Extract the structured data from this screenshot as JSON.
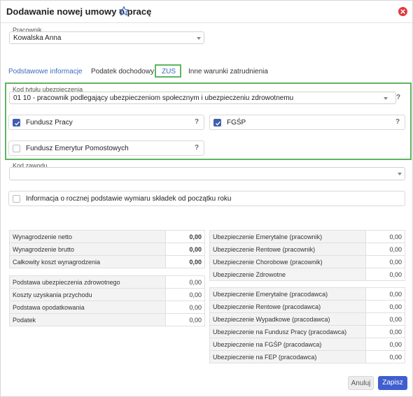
{
  "dialog": {
    "title": "Dodawanie nowej umowy o pracę"
  },
  "employee": {
    "label": "Pracownik",
    "value": "Kowalska Anna"
  },
  "tabs": [
    {
      "label": "Podstawowe informacje"
    },
    {
      "label": "Podatek dochodowy"
    },
    {
      "label": "ZUS"
    },
    {
      "label": "Inne warunki zatrudnienia"
    }
  ],
  "zus": {
    "insurance_code_label": "Kod tytułu ubezpieczenia",
    "insurance_code_value": "01 10 - pracownik podlegający ubezpieczeniom społecznym i ubezpieczeniu zdrowotnemu",
    "help": "?",
    "fp_label": "Fundusz Pracy",
    "fp_checked": true,
    "fgsp_label": "FGŚP",
    "fgsp_checked": true,
    "fep_label": "Fundusz Emerytur Pomostowych",
    "fep_checked": false,
    "profession_label": "Kod zawodu",
    "profession_value": "",
    "annual_info_label": "Informacja o rocznej podstawie wymiaru składek od początku roku",
    "annual_info_checked": false
  },
  "summary_left_top": [
    {
      "label": "Wynagrodzenie netto",
      "value": "0,00"
    },
    {
      "label": "Wynagrodzenie brutto",
      "value": "0,00"
    },
    {
      "label": "Całkowity koszt wynagrodzenia",
      "value": "0,00"
    }
  ],
  "summary_left_bottom": [
    {
      "label": "Podstawa ubezpieczenia zdrowotnego",
      "value": "0,00"
    },
    {
      "label": "Koszty uzyskania przychodu",
      "value": "0,00"
    },
    {
      "label": "Podstawa opodatkowania",
      "value": "0,00"
    },
    {
      "label": "Podatek",
      "value": "0,00"
    }
  ],
  "summary_right_top": [
    {
      "label": "Ubezpieczenie Emerytalne (pracownik)",
      "value": "0,00"
    },
    {
      "label": "Ubezpieczenie Rentowe (pracownik)",
      "value": "0,00"
    },
    {
      "label": "Ubezpieczenie Chorobowe (pracownik)",
      "value": "0,00"
    },
    {
      "label": "Ubezpieczenie Zdrowotne",
      "value": "0,00"
    }
  ],
  "summary_right_bottom": [
    {
      "label": "Ubezpieczenie Emerytalne (pracodawca)",
      "value": "0,00"
    },
    {
      "label": "Ubezpieczenie Rentowe (pracodawca)",
      "value": "0,00"
    },
    {
      "label": "Ubezpieczenie Wypadkowe (pracodawca)",
      "value": "0,00"
    },
    {
      "label": "Ubezpieczenie na Fundusz Pracy (pracodawca)",
      "value": "0,00"
    },
    {
      "label": "Ubezpieczenie na FGŚP (pracodawca)",
      "value": "0,00"
    },
    {
      "label": "Ubezpieczenie na FEP (pracodawca)",
      "value": "0,00"
    }
  ],
  "footer": {
    "cancel_label": "Anuluj",
    "save_label": "Zapisz"
  },
  "colors": {
    "accent": "#3f5fcf",
    "highlight": "#5fb560",
    "close": "#e0393e"
  }
}
